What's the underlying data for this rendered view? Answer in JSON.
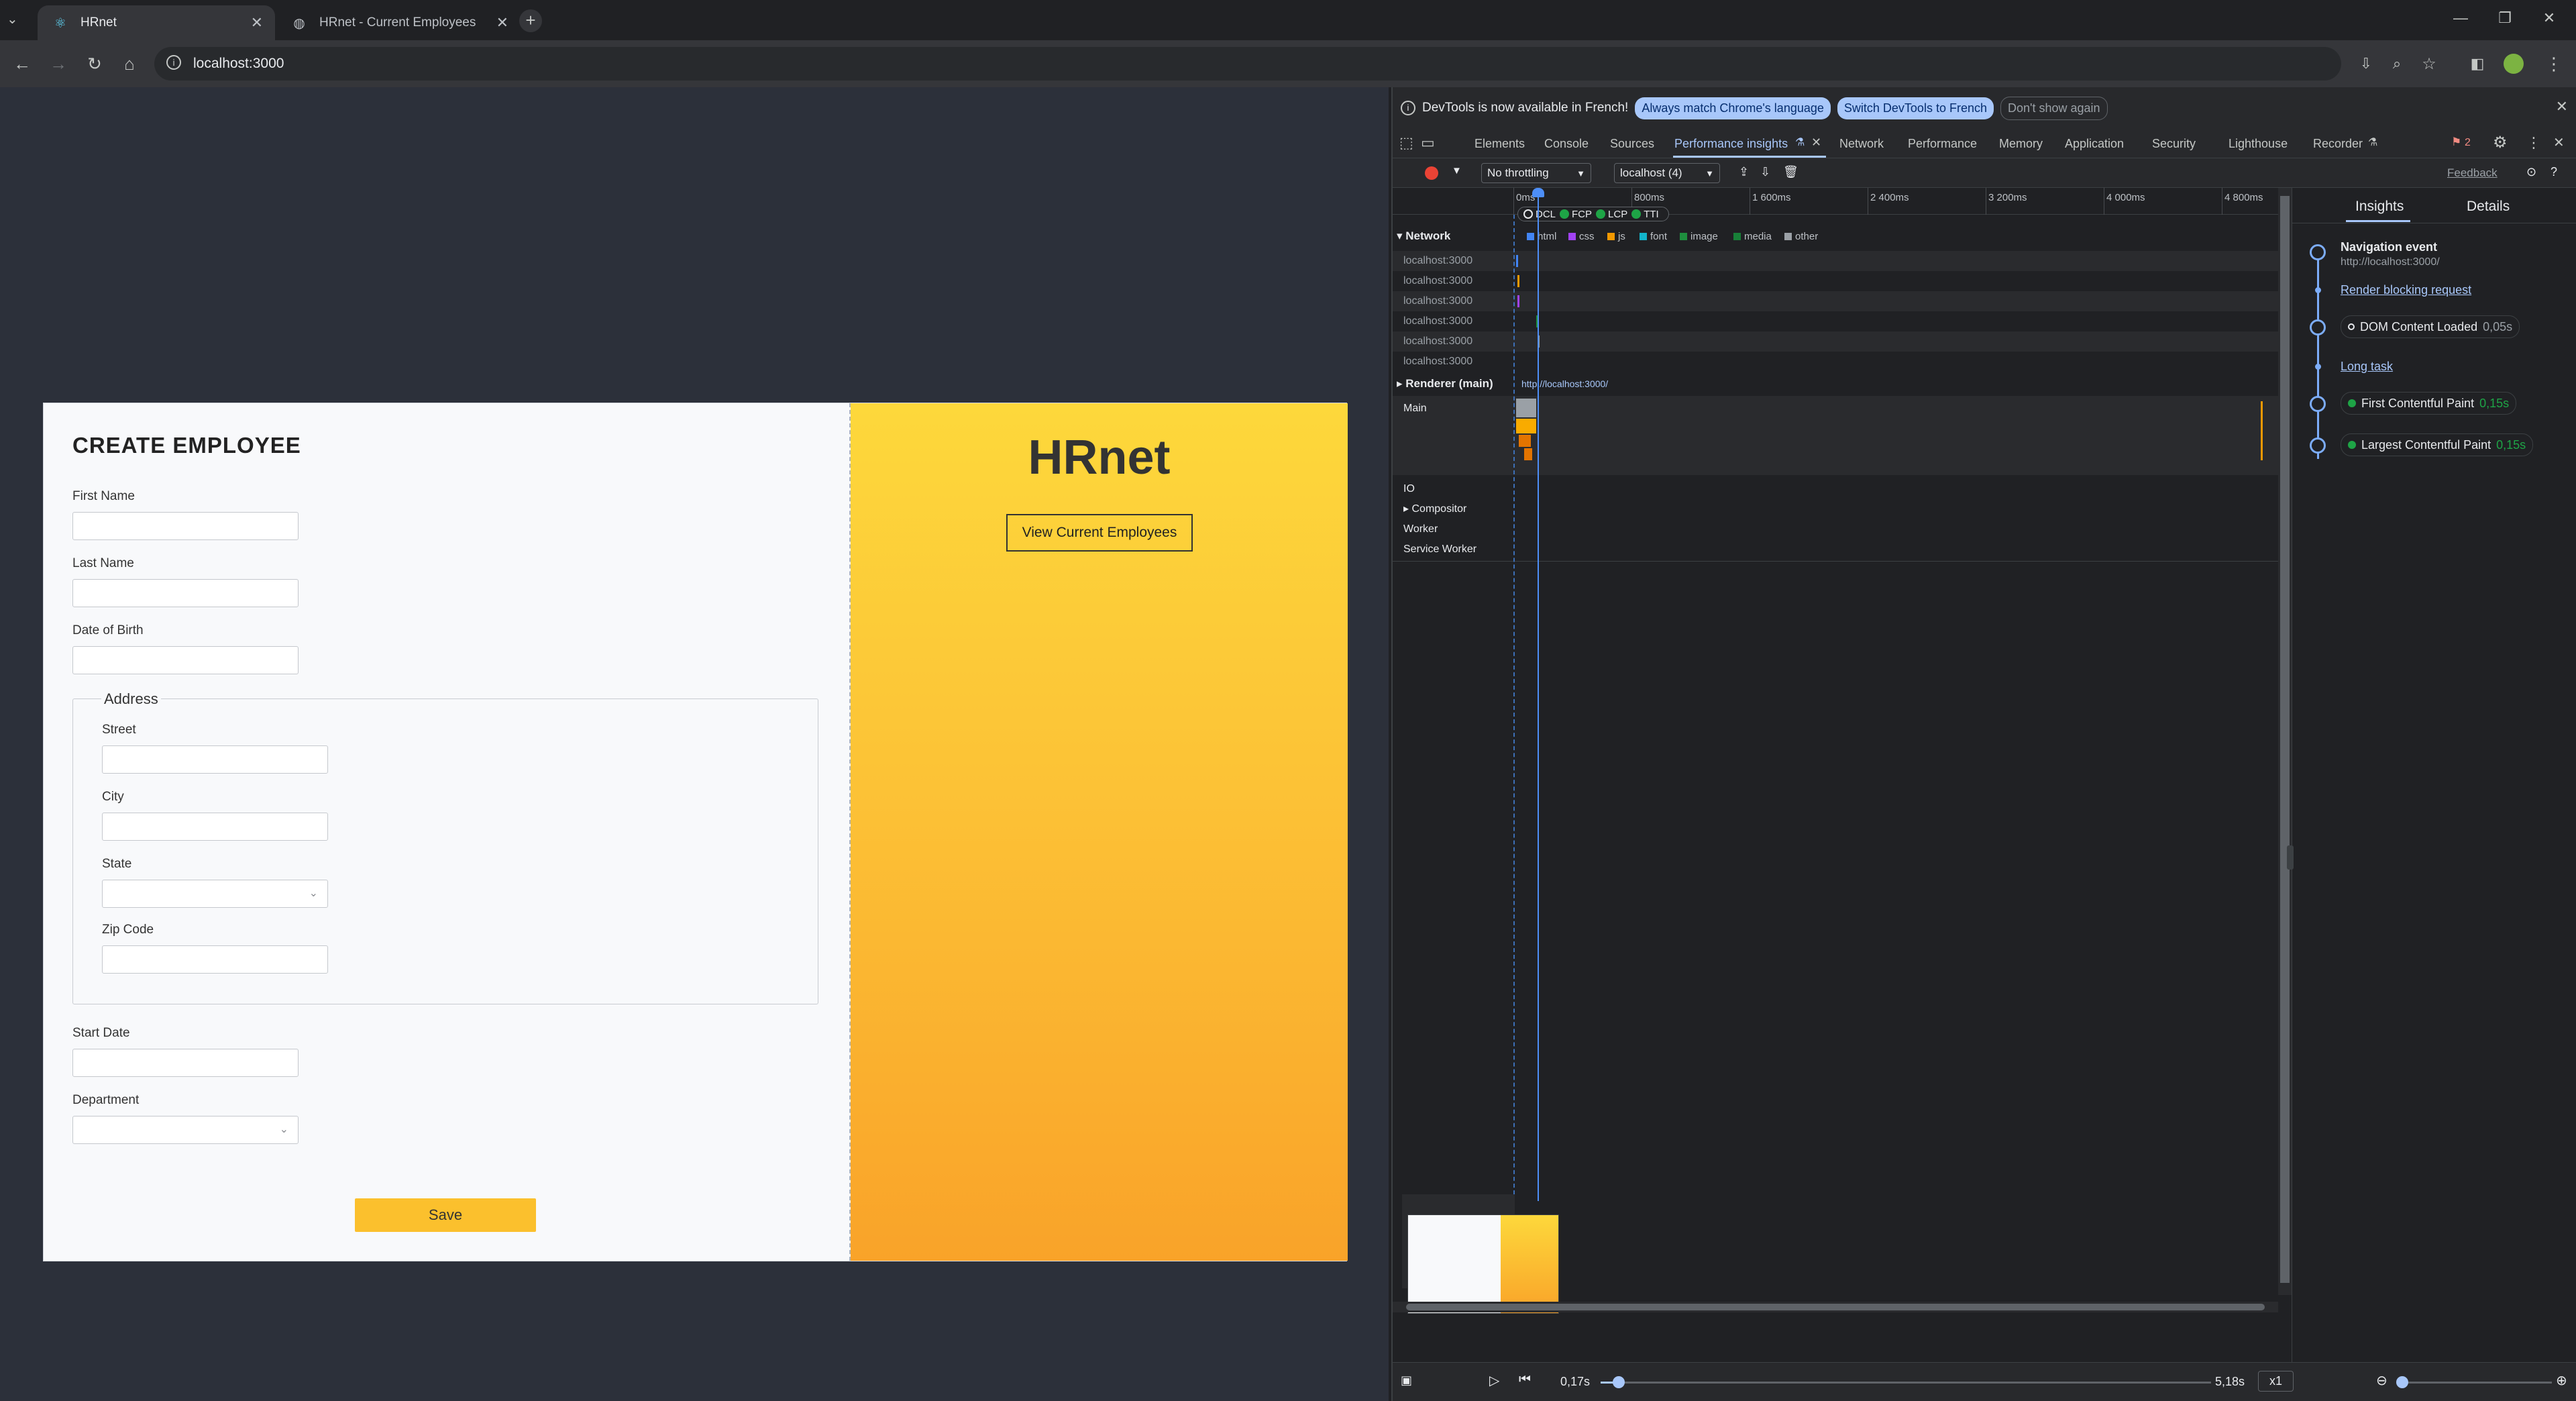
{
  "browser": {
    "tabs": [
      {
        "title": "HRnet",
        "active": true
      },
      {
        "title": "HRnet - Current Employees",
        "active": false
      }
    ],
    "url": "localhost:3000"
  },
  "form": {
    "title": "CREATE EMPLOYEE",
    "first_name_label": "First Name",
    "last_name_label": "Last Name",
    "dob_label": "Date of Birth",
    "address_legend": "Address",
    "street_label": "Street",
    "city_label": "City",
    "state_label": "State",
    "zip_label": "Zip Code",
    "start_date_label": "Start Date",
    "department_label": "Department",
    "save_label": "Save"
  },
  "brand": {
    "title": "HRnet",
    "view_employees_label": "View Current Employees"
  },
  "devtools": {
    "info_message": "DevTools is now available in French!",
    "info_btn_match": "Always match Chrome's language",
    "info_btn_switch": "Switch DevTools to French",
    "info_btn_dismiss": "Don't show again",
    "tabs": [
      "Elements",
      "Console",
      "Sources",
      "Performance insights",
      "Network",
      "Performance",
      "Memory",
      "Application",
      "Security",
      "Lighthouse",
      "Recorder"
    ],
    "issues_count": "2",
    "throttling": "No throttling",
    "target": "localhost (4)",
    "feedback": "Feedback",
    "ruler": [
      "0ms",
      "800ms",
      "1 600ms",
      "2 400ms",
      "3 200ms",
      "4 000ms",
      "4 800ms"
    ],
    "markers": [
      "DCL",
      "FCP",
      "LCP",
      "TTI"
    ],
    "network_label": "Network",
    "legend": [
      "html",
      "css",
      "js",
      "font",
      "image",
      "media",
      "other"
    ],
    "network_rows": [
      "localhost:3000",
      "localhost:3000",
      "localhost:3000",
      "localhost:3000",
      "localhost:3000",
      "localhost:3000"
    ],
    "renderer_label": "Renderer (main)",
    "renderer_url": "http://localhost:3000/",
    "main_label": "Main",
    "tracks": [
      "IO",
      "Compositor",
      "Worker",
      "Service Worker"
    ],
    "insights_tab": "Insights",
    "details_tab": "Details",
    "nav_event_title": "Navigation event",
    "nav_event_url": "http://localhost:3000/",
    "render_blocking": "Render blocking request",
    "dcl_label": "DOM Content Loaded",
    "dcl_time": "0,05s",
    "long_task": "Long task",
    "fcp_label": "First Contentful Paint",
    "fcp_time": "0,15s",
    "lcp_label": "Largest Contentful Paint",
    "lcp_time": "0,15s",
    "playback_start": "0,17s",
    "playback_end": "5,18s",
    "speed": "x1",
    "playback_progress": 0.03
  }
}
